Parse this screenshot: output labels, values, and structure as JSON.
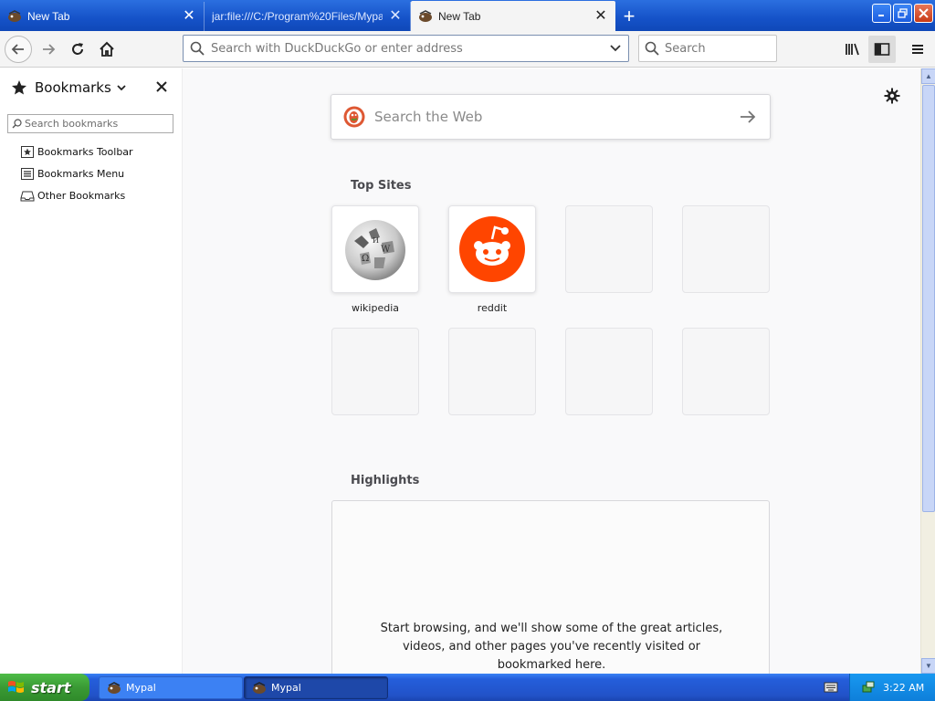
{
  "tabs": [
    {
      "title": "New Tab",
      "active": false
    },
    {
      "title": "jar:file:///C:/Program%20Files/Mypal/",
      "active": false
    },
    {
      "title": "New Tab",
      "active": true
    }
  ],
  "new_tab_symbol": "+",
  "window_controls": {
    "minimize": "_",
    "maximize": "❐",
    "close": "✕"
  },
  "navbar": {
    "url_placeholder": "Search with DuckDuckGo or enter address",
    "search_placeholder": "Search"
  },
  "sidebar": {
    "title": "Bookmarks",
    "search_placeholder": "Search bookmarks",
    "items": [
      {
        "label": "Bookmarks Toolbar",
        "icon": "bookmarks-toolbar-icon"
      },
      {
        "label": "Bookmarks Menu",
        "icon": "bookmarks-menu-icon"
      },
      {
        "label": "Other Bookmarks",
        "icon": "other-bookmarks-icon"
      }
    ]
  },
  "newtab": {
    "search_placeholder": "Search the Web",
    "top_sites_title": "Top Sites",
    "top_sites": [
      {
        "label": "wikipedia",
        "icon": "wikipedia-globe-icon"
      },
      {
        "label": "reddit",
        "icon": "reddit-alien-icon"
      }
    ],
    "highlights_title": "Highlights",
    "highlights_message": "Start browsing, and we'll show some of the great articles, videos, and other pages you've recently visited or bookmarked here."
  },
  "taskbar": {
    "start_label": "start",
    "tasks": [
      {
        "label": "Mypal",
        "active": false
      },
      {
        "label": "Mypal",
        "active": true
      }
    ],
    "clock": "3:22 AM"
  },
  "colors": {
    "xp_blue": "#245edb",
    "reddit_orange": "#ff4500",
    "ddg_orange": "#de5833",
    "start_green": "#3a9a34"
  }
}
